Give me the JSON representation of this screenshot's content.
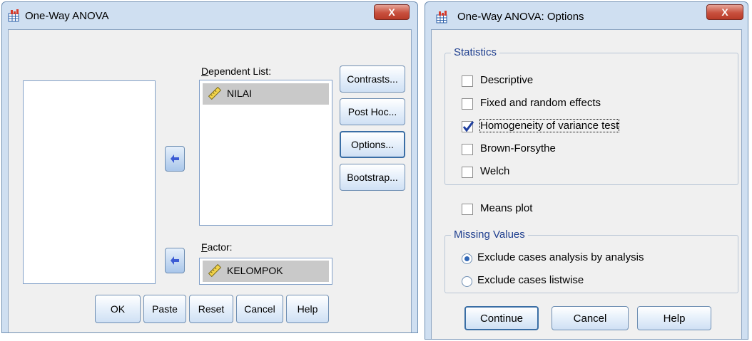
{
  "anova_dialog": {
    "title": "One-Way ANOVA",
    "close_label": "X",
    "dependent_list_label": "Dependent List:",
    "dependent_items": [
      "NILAI"
    ],
    "factor_label": "Factor:",
    "factor_value": "KELOMPOK",
    "side_buttons": [
      "Contrasts...",
      "Post Hoc...",
      "Options...",
      "Bootstrap..."
    ],
    "bottom_buttons": [
      "OK",
      "Paste",
      "Reset",
      "Cancel",
      "Help"
    ]
  },
  "options_dialog": {
    "title": "One-Way ANOVA: Options",
    "close_label": "X",
    "statistics_group": {
      "title": "Statistics",
      "items": [
        {
          "label": "Descriptive",
          "checked": false
        },
        {
          "label": "Fixed and random effects",
          "checked": false
        },
        {
          "label": "Homogeneity of variance test",
          "checked": true
        },
        {
          "label": "Brown-Forsythe",
          "checked": false
        },
        {
          "label": "Welch",
          "checked": false
        }
      ]
    },
    "means_plot": {
      "label": "Means plot",
      "checked": false
    },
    "missing_values_group": {
      "title": "Missing Values",
      "options": [
        {
          "label": "Exclude cases analysis by analysis",
          "selected": true
        },
        {
          "label": "Exclude cases listwise",
          "selected": false
        }
      ]
    },
    "buttons": [
      "Continue",
      "Cancel",
      "Help"
    ]
  }
}
